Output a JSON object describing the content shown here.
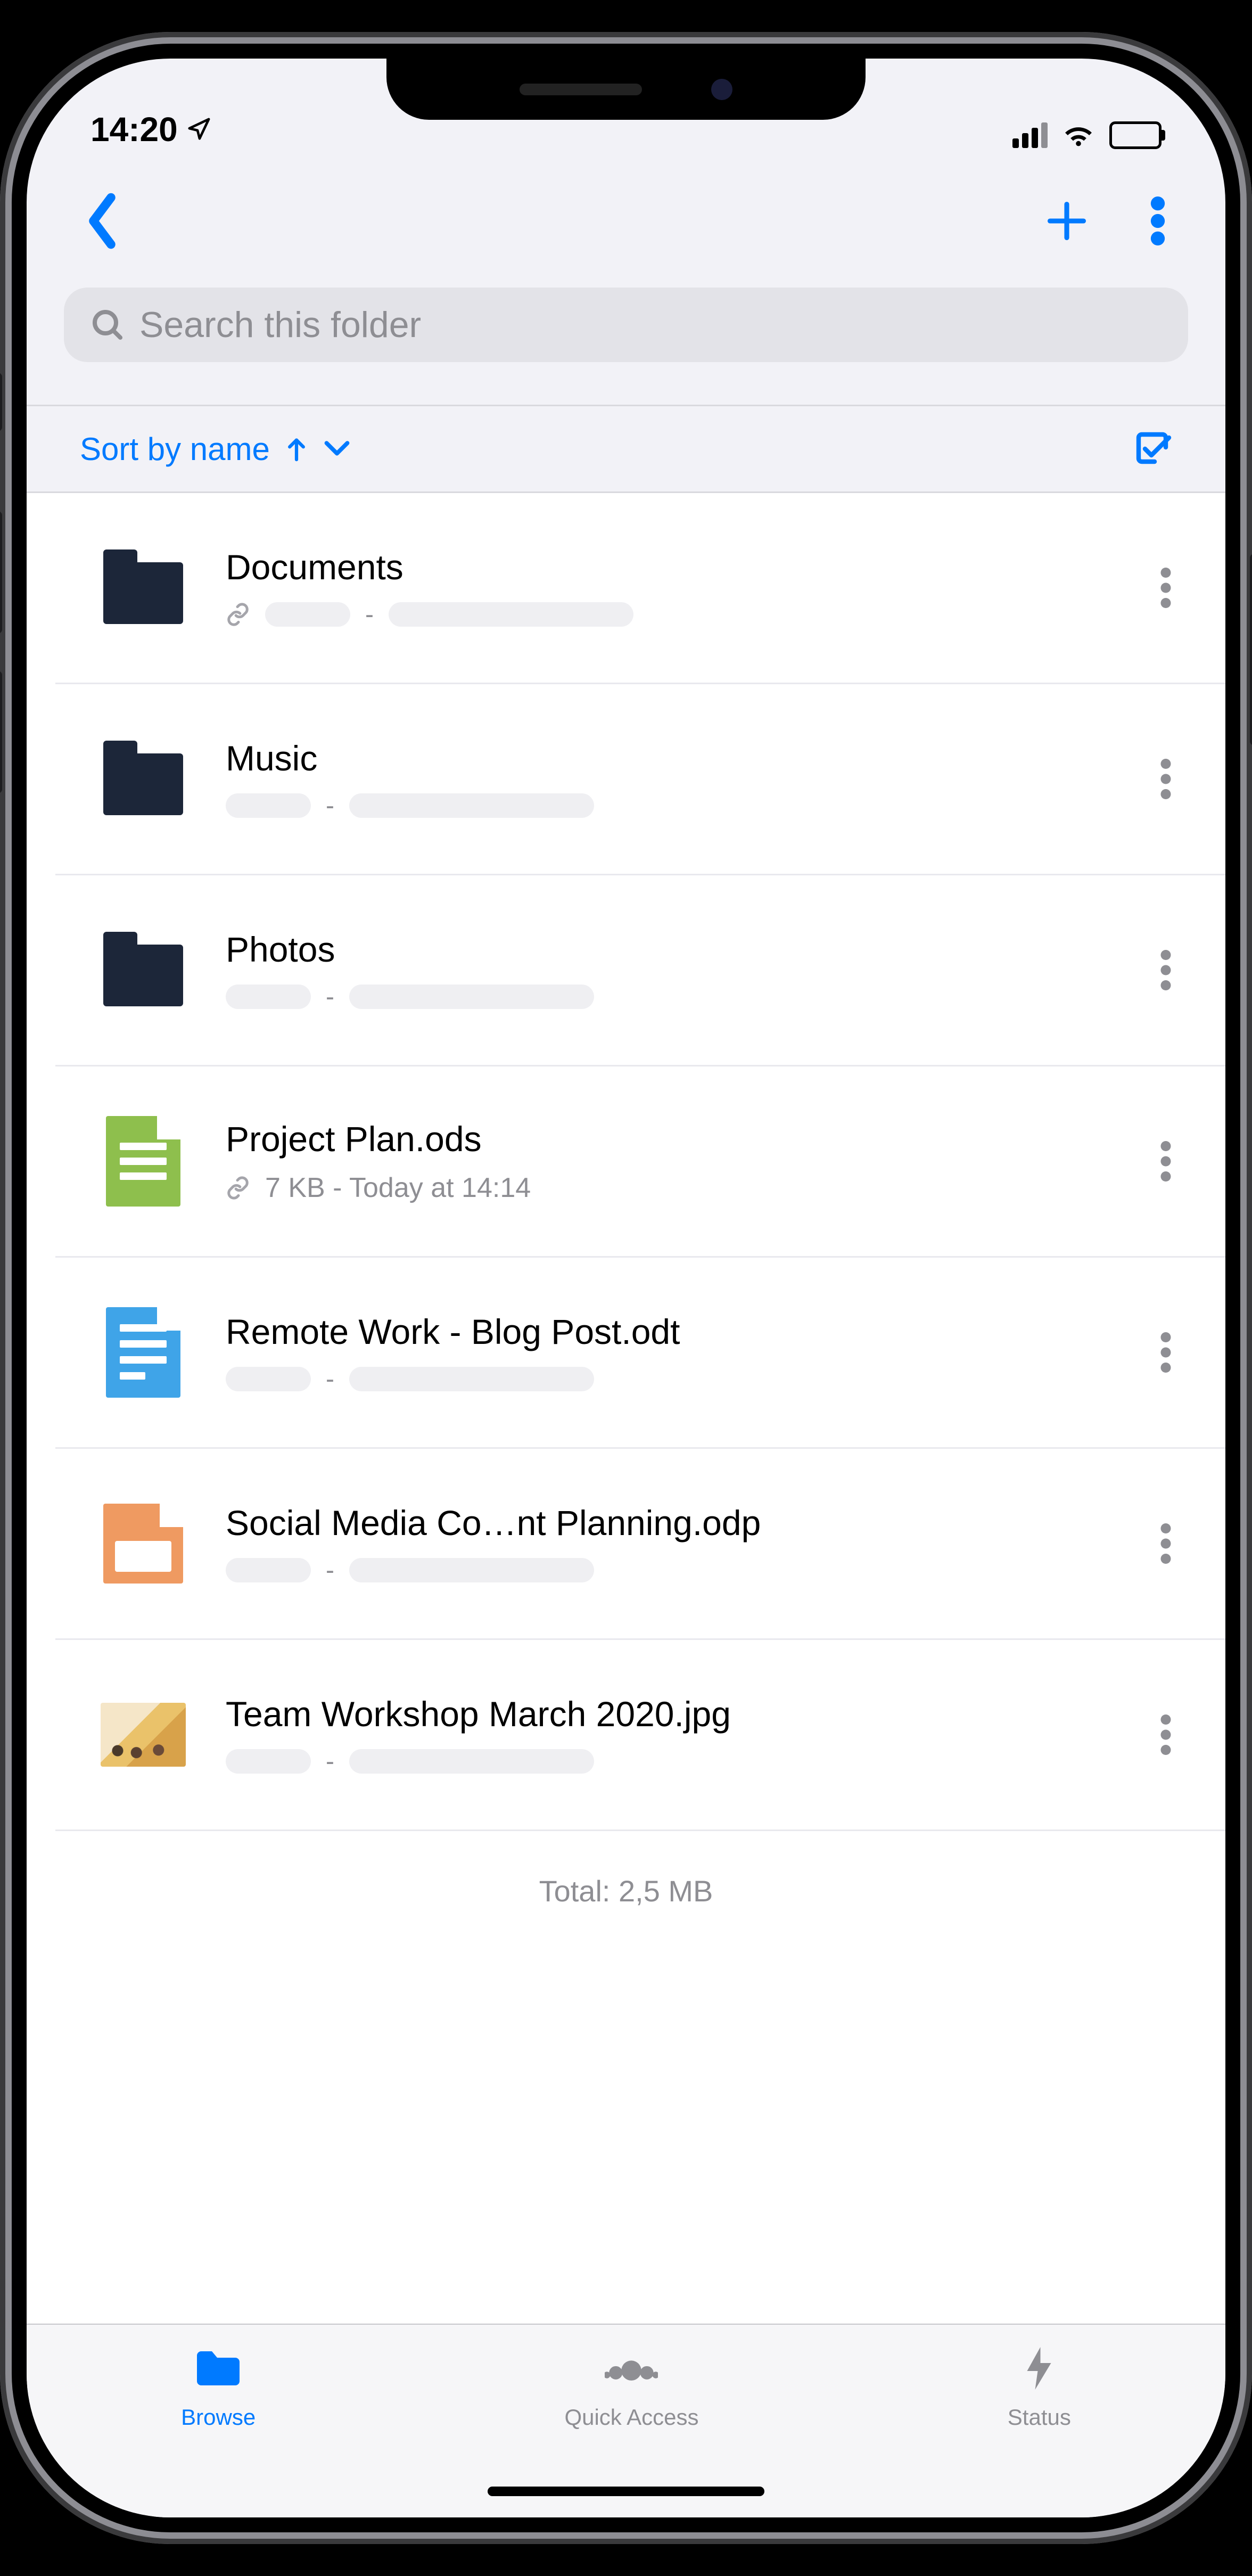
{
  "status": {
    "time": "14:20"
  },
  "search": {
    "placeholder": "Search this folder"
  },
  "sort": {
    "label": "Sort by name"
  },
  "files": [
    {
      "name": "Documents",
      "type": "folder",
      "link": true,
      "meta": null
    },
    {
      "name": "Music",
      "type": "folder",
      "link": false,
      "meta": null
    },
    {
      "name": "Photos",
      "type": "folder",
      "link": false,
      "meta": null
    },
    {
      "name": "Project Plan.ods",
      "type": "spreadsheet",
      "link": true,
      "meta": "7 KB  -  Today at 14:14"
    },
    {
      "name": "Remote Work - Blog Post.odt",
      "type": "document",
      "link": false,
      "meta": null
    },
    {
      "name": "Social Media Co…nt Planning.odp",
      "type": "presentation",
      "link": false,
      "meta": null
    },
    {
      "name": "Team Workshop March 2020.jpg",
      "type": "image",
      "link": false,
      "meta": null
    }
  ],
  "total": "Total: 2,5 MB",
  "tabs": [
    {
      "id": "browse",
      "label": "Browse",
      "active": true
    },
    {
      "id": "quick-access",
      "label": "Quick Access",
      "active": false
    },
    {
      "id": "status",
      "label": "Status",
      "active": false
    }
  ]
}
